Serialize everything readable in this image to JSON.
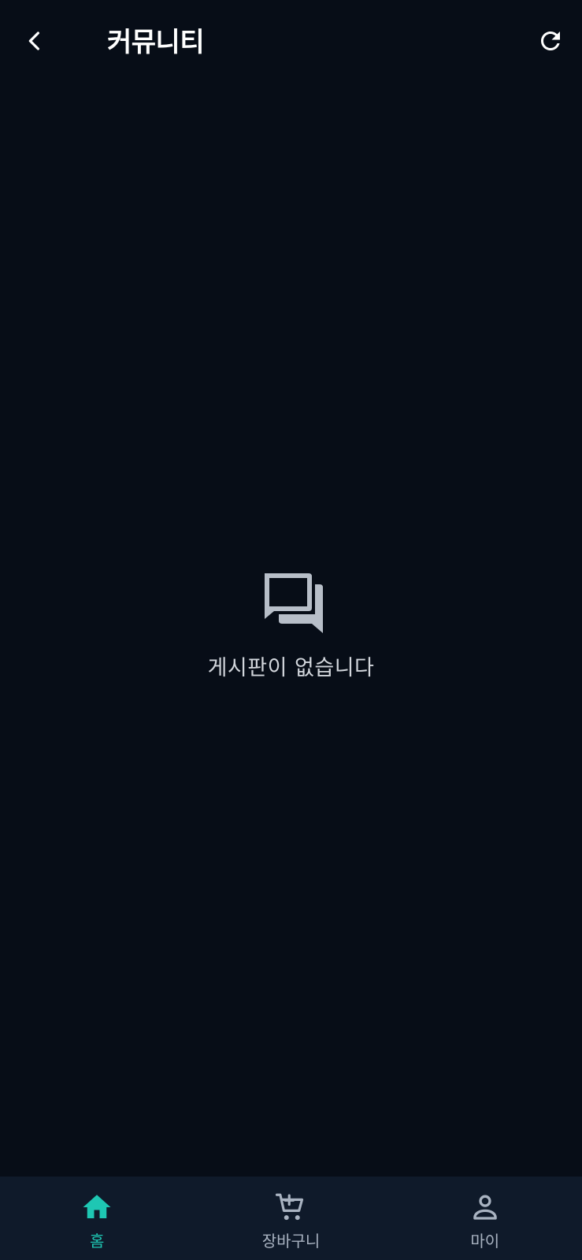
{
  "header": {
    "title": "커뮤니티",
    "back_icon": "chevron-left-icon",
    "refresh_icon": "refresh-icon"
  },
  "empty_state": {
    "icon": "forum-icon",
    "message": "게시판이 없습니다"
  },
  "bottom_nav": {
    "items": [
      {
        "label": "홈",
        "icon": "home-icon",
        "active": true
      },
      {
        "label": "장바구니",
        "icon": "cart-icon",
        "active": false
      },
      {
        "label": "마이",
        "icon": "person-icon",
        "active": false
      }
    ]
  },
  "colors": {
    "background": "#070d17",
    "nav_background": "#0f1a2a",
    "accent": "#1ec7b3",
    "inactive": "#a9b3c1",
    "empty_icon": "#b7bec8"
  }
}
